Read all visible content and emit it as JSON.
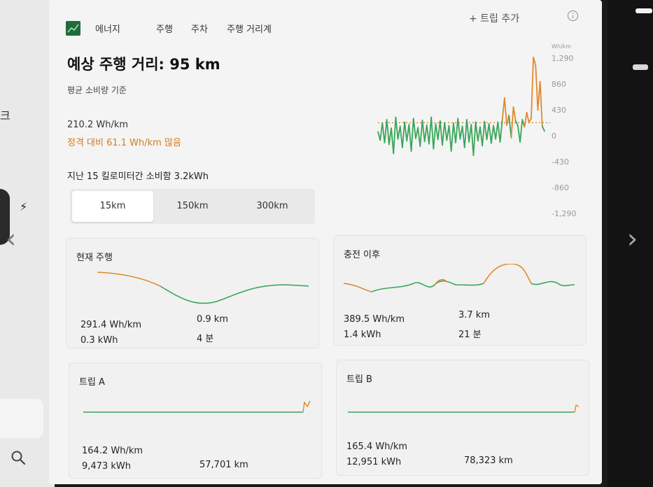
{
  "left_panel": {
    "fragment_text": "크",
    "bolt_icon": "bolt-icon",
    "nav_icon": "chevron-left-icon",
    "search_icon": "search-icon"
  },
  "right_panel": {
    "nav_icon": "chevron-right-icon"
  },
  "header": {
    "app_icon": "energy-graph-icon",
    "app_label": "에너지",
    "tabs": [
      "주행",
      "주차",
      "주행 거리계"
    ],
    "add_trip_label": "+ 트립 추가",
    "info_icon": "info-icon"
  },
  "summary": {
    "title": "예상 주행 거리: 95 km",
    "subtitle": "평균 소비량 기준",
    "avg_consumption": "210.2 Wh/km",
    "diff_text": "정격 대비 61.1 Wh/km 많음",
    "recent_label": "지난 15 킬로미터간 소비함 3.2kWh"
  },
  "range_tabs": {
    "options": [
      "15km",
      "150km",
      "300km"
    ],
    "selected": "15km"
  },
  "chart": {
    "unit": "Wh/km",
    "yticks": [
      "1,290",
      "860",
      "430",
      "0",
      "-430",
      "-860",
      "-1,290"
    ],
    "colors": {
      "positive": "#e08a2a",
      "negative": "#3aa55a",
      "reference": "#d97a1a"
    }
  },
  "chart_data": {
    "type": "line",
    "ylabel": "Wh/km",
    "ylim": [
      -1290,
      1290
    ],
    "reference_line": 210,
    "values": [
      60,
      -80,
      200,
      -120,
      260,
      -150,
      120,
      -300,
      300,
      -60,
      150,
      -200,
      220,
      -90,
      180,
      -260,
      280,
      -50,
      130,
      -180,
      250,
      -100,
      170,
      -140,
      300,
      -220,
      190,
      -70,
      240,
      -160,
      210,
      -80,
      160,
      -260,
      200,
      -120,
      280,
      -60,
      150,
      -200,
      260,
      -110,
      180,
      -330,
      220,
      -90,
      140,
      -170,
      230,
      -70,
      190,
      -130,
      160,
      -60,
      220,
      -110,
      260,
      620,
      170,
      330,
      -40,
      470,
      240,
      160,
      -110,
      260,
      140,
      380,
      210,
      280,
      1290,
      1160,
      420,
      890,
      150,
      70
    ]
  },
  "tiles": [
    {
      "title": "현재 주행",
      "stats": [
        "291.4 Wh/km",
        "0.3 kWh",
        "0.9 km",
        "4 분"
      ]
    },
    {
      "title": "충전 이후",
      "stats": [
        "389.5 Wh/km",
        "1.4 kWh",
        "3.7 km",
        "21 분"
      ]
    },
    {
      "title": "트립 A",
      "stats": [
        "164.2 Wh/km",
        "9,473 kWh",
        "57,701 km"
      ]
    },
    {
      "title": "트립 B",
      "stats": [
        "165.4 Wh/km",
        "12,951 kWh",
        "78,323 km"
      ]
    }
  ]
}
